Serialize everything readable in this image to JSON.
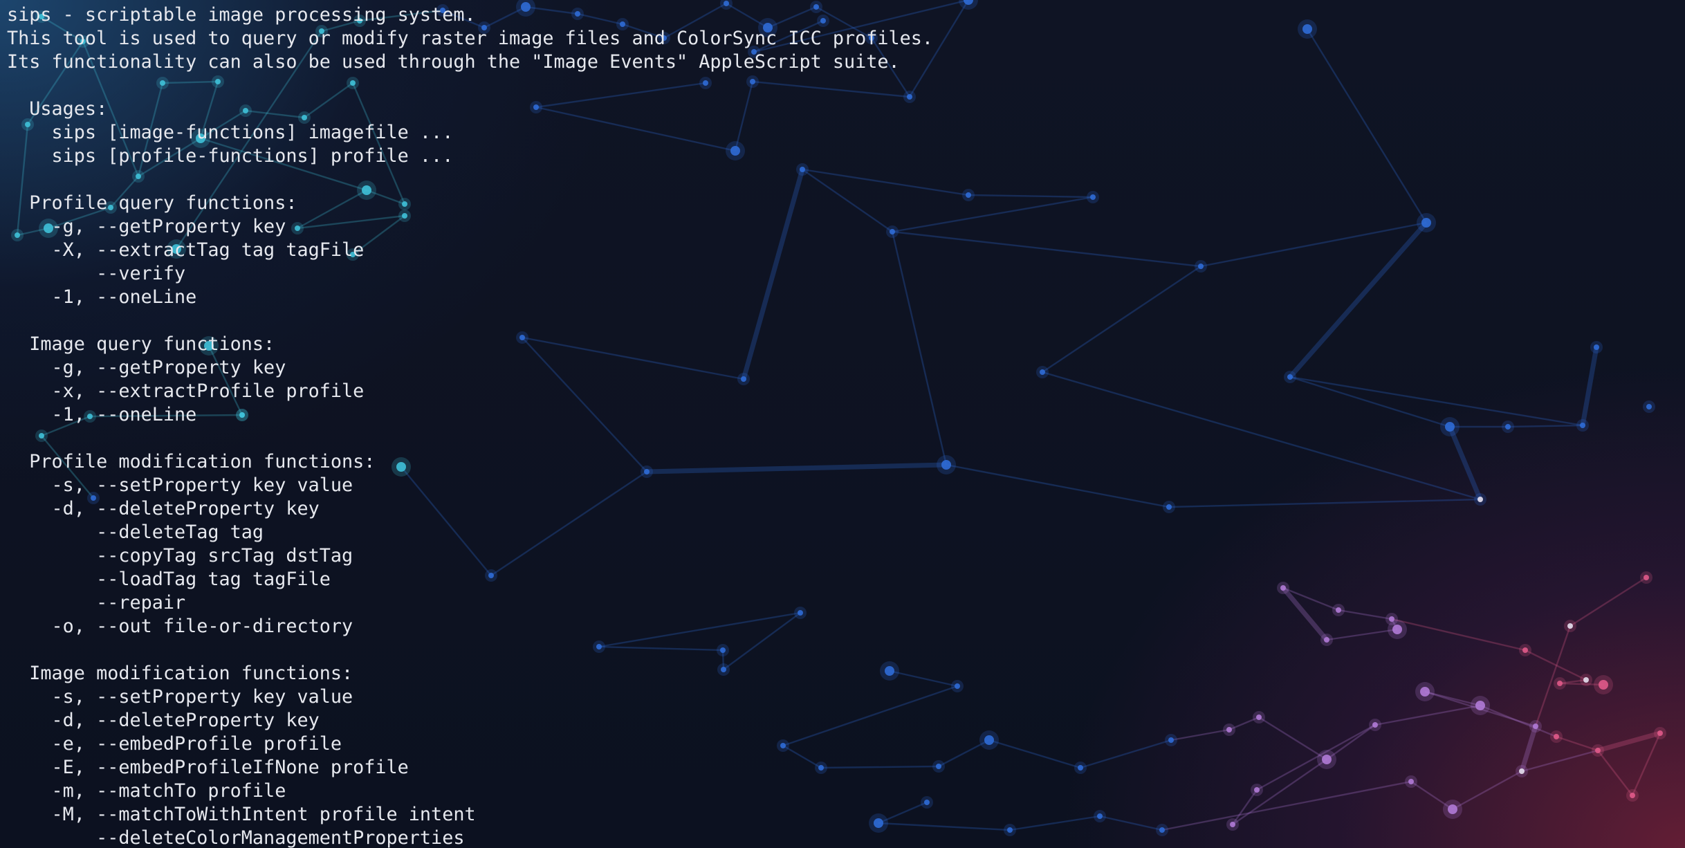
{
  "terminal": {
    "lines": [
      "sips - scriptable image processing system.",
      "This tool is used to query or modify raster image files and ColorSync ICC profiles.",
      "Its functionality can also be used through the \"Image Events\" AppleScript suite.",
      "",
      "  Usages:",
      "    sips [image-functions] imagefile ...",
      "    sips [profile-functions] profile ...",
      "",
      "  Profile query functions:",
      "    -g, --getProperty key",
      "    -X, --extractTag tag tagFile",
      "        --verify",
      "    -1, --oneLine",
      "",
      "  Image query functions:",
      "    -g, --getProperty key",
      "    -x, --extractProfile profile",
      "    -1, --oneLine",
      "",
      "  Profile modification functions:",
      "    -s, --setProperty key value",
      "    -d, --deleteProperty key",
      "        --deleteTag tag",
      "        --copyTag srcTag dstTag",
      "        --loadTag tag tagFile",
      "        --repair",
      "    -o, --out file-or-directory",
      "",
      "  Image modification functions:",
      "    -s, --setProperty key value",
      "    -d, --deleteProperty key",
      "    -e, --embedProfile profile",
      "    -E, --embedProfileIfNone profile",
      "    -m, --matchTo profile",
      "    -M, --matchToWithIntent profile intent",
      "        --deleteColorManagementProperties"
    ]
  },
  "wallpaper": {
    "colors": {
      "background": "#0d1220",
      "cyan_nodes": "#3fc1d8",
      "blue_nodes": "#2f6bd6",
      "purple_nodes": "#b07ad6",
      "pink_nodes": "#e05a8a",
      "text": "#e6e8ee"
    }
  }
}
